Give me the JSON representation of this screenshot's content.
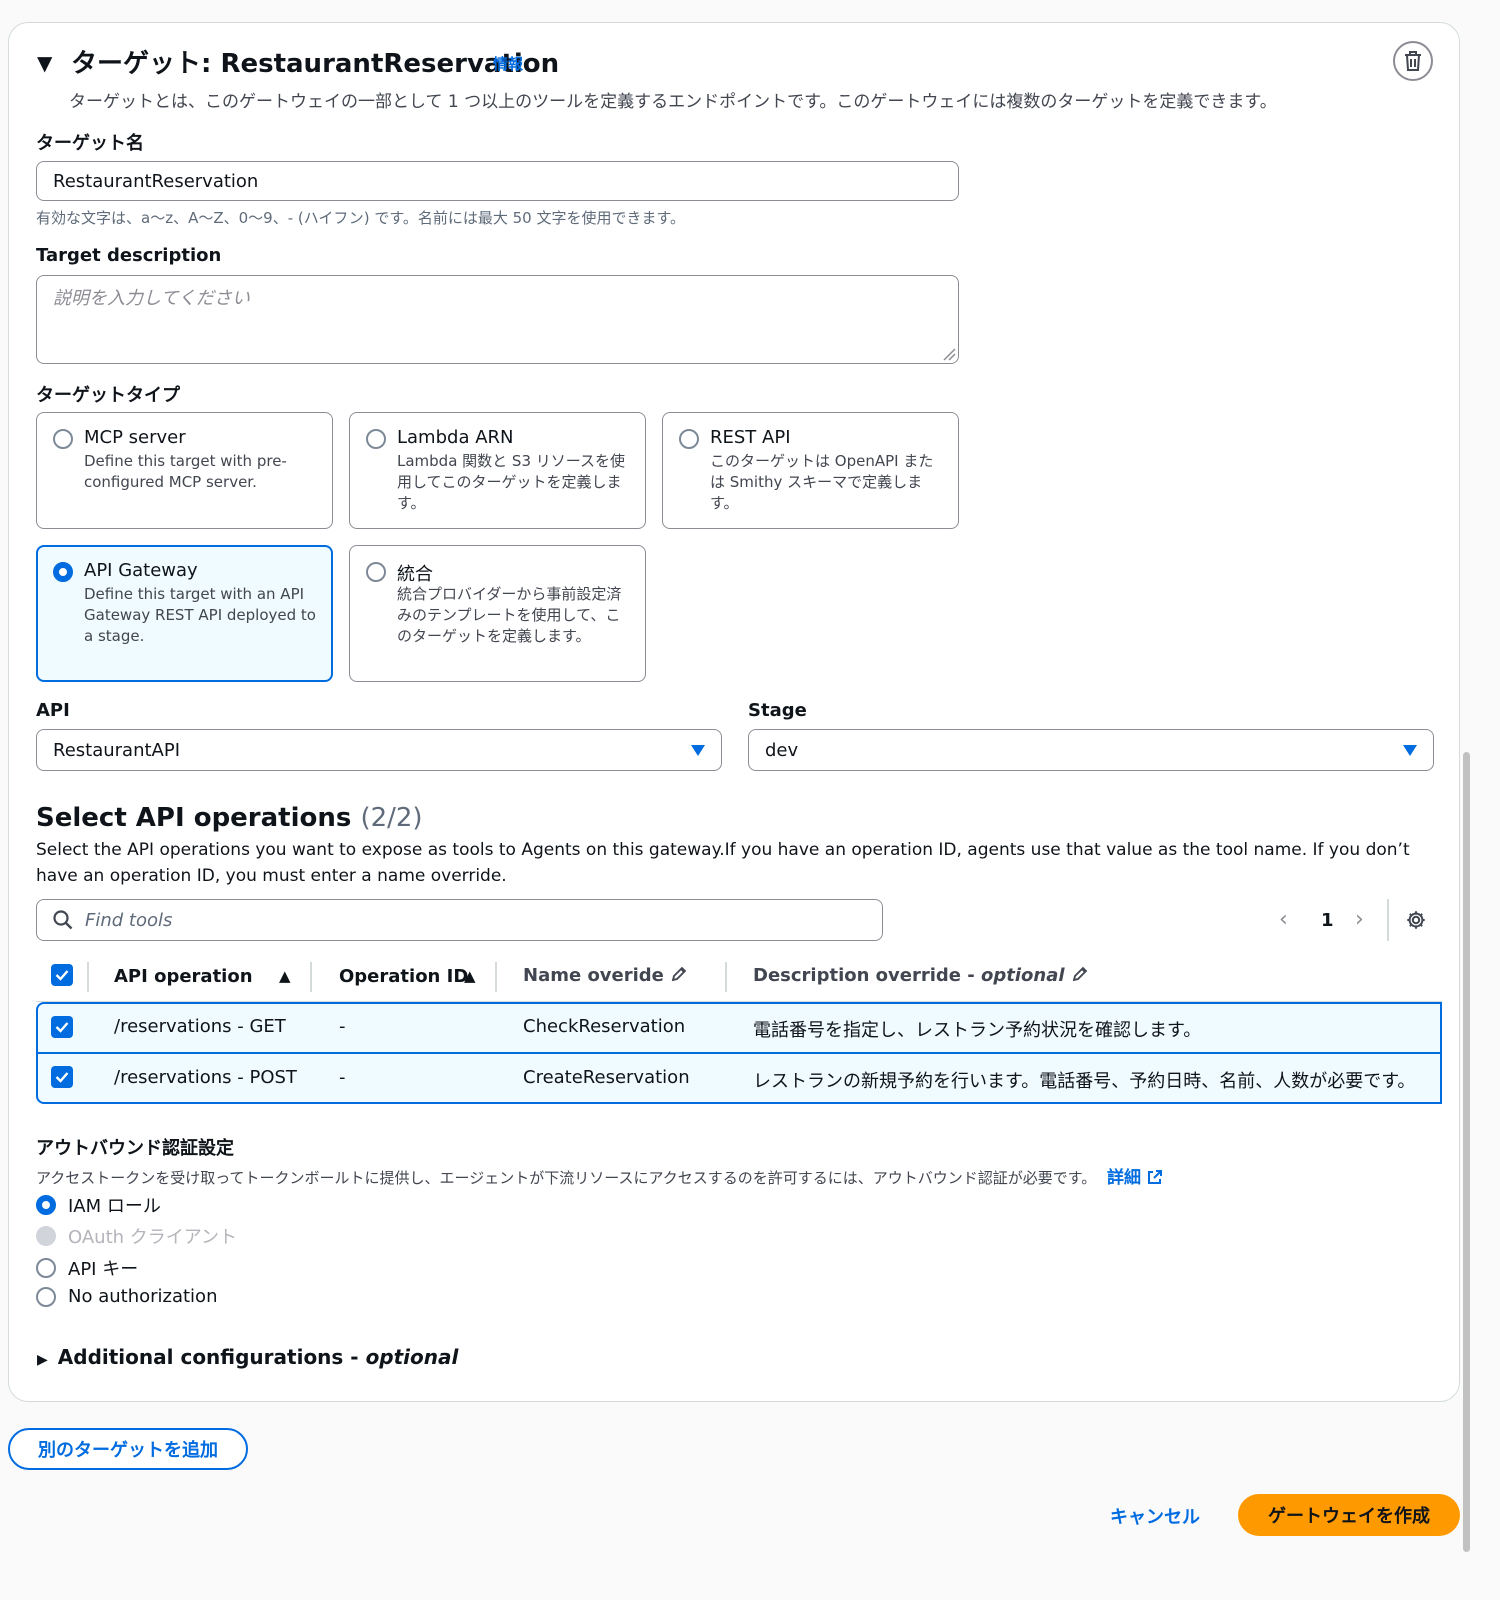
{
  "header": {
    "title": "ターゲット: RestaurantReservation",
    "info_link": "情報",
    "description": "ターゲットとは、このゲートウェイの一部として 1 つ以上のツールを定義するエンドポイントです。このゲートウェイには複数のターゲットを定義できます。"
  },
  "target_name": {
    "label": "ターゲット名",
    "value": "RestaurantReservation",
    "hint": "有効な文字は、a〜z、A〜Z、0〜9、- (ハイフン) です。名前には最大 50 文字を使用できます。"
  },
  "target_description": {
    "label": "Target description",
    "placeholder": "説明を入力してください"
  },
  "target_type": {
    "label": "ターゲットタイプ",
    "options": [
      {
        "title": "MCP server",
        "description": "Define this target with pre-configured MCP server.",
        "selected": false
      },
      {
        "title": "Lambda ARN",
        "description": "Lambda 関数と S3 リソースを使用してこのターゲットを定義します。",
        "selected": false
      },
      {
        "title": "REST API",
        "description": "このターゲットは OpenAPI または Smithy スキーマで定義します。",
        "selected": false
      },
      {
        "title": "API Gateway",
        "description": "Define this target with an API Gateway REST API deployed to a stage.",
        "selected": true
      },
      {
        "title": "統合",
        "description": "統合プロバイダーから事前設定済みのテンプレートを使用して、このターゲットを定義します。",
        "selected": false
      }
    ]
  },
  "api": {
    "label": "API",
    "value": "RestaurantAPI"
  },
  "stage": {
    "label": "Stage",
    "value": "dev"
  },
  "operations": {
    "title": "Select API operations",
    "count": "(2/2)",
    "description": "Select the API operations you want to expose as tools to Agents on this gateway.If you have an operation ID, agents use that value as the tool name. If you don’t have an operation ID, you must enter a name override.",
    "search_placeholder": "Find tools",
    "page": "1",
    "columns": {
      "api_operation": "API operation",
      "operation_id": "Operation ID",
      "name_override": "Name overide",
      "description_override": "Description override - ",
      "optional": "optional"
    },
    "rows": [
      {
        "api_operation": "/reservations - GET",
        "operation_id": "-",
        "name_override": "CheckReservation",
        "description_override": "電話番号を指定し、レストラン予約状況を確認します。"
      },
      {
        "api_operation": "/reservations - POST",
        "operation_id": "-",
        "name_override": "CreateReservation",
        "description_override": "レストランの新規予約を行います。電話番号、予約日時、名前、人数が必要です。"
      }
    ]
  },
  "outbound_auth": {
    "label": "アウトバウンド認証設定",
    "description": "アクセストークンを受け取ってトークンボールトに提供し、エージェントが下流リソースにアクセスするのを許可するには、アウトバウンド認証が必要です。",
    "details_link": "詳細",
    "options": [
      {
        "label": "IAM ロール",
        "state": "selected"
      },
      {
        "label": "OAuth クライアント",
        "state": "disabled"
      },
      {
        "label": "API キー",
        "state": "off"
      },
      {
        "label": "No authorization",
        "state": "off"
      }
    ]
  },
  "additional": {
    "label": "Additional configurations - ",
    "optional": "optional"
  },
  "buttons": {
    "add_target": "別のターゲットを追加",
    "cancel": "キャンセル",
    "create": "ゲートウェイを作成"
  },
  "colors": {
    "accent": "#006ce0",
    "primary_button": "#ff9900",
    "selected_bg": "#f0fbff"
  }
}
